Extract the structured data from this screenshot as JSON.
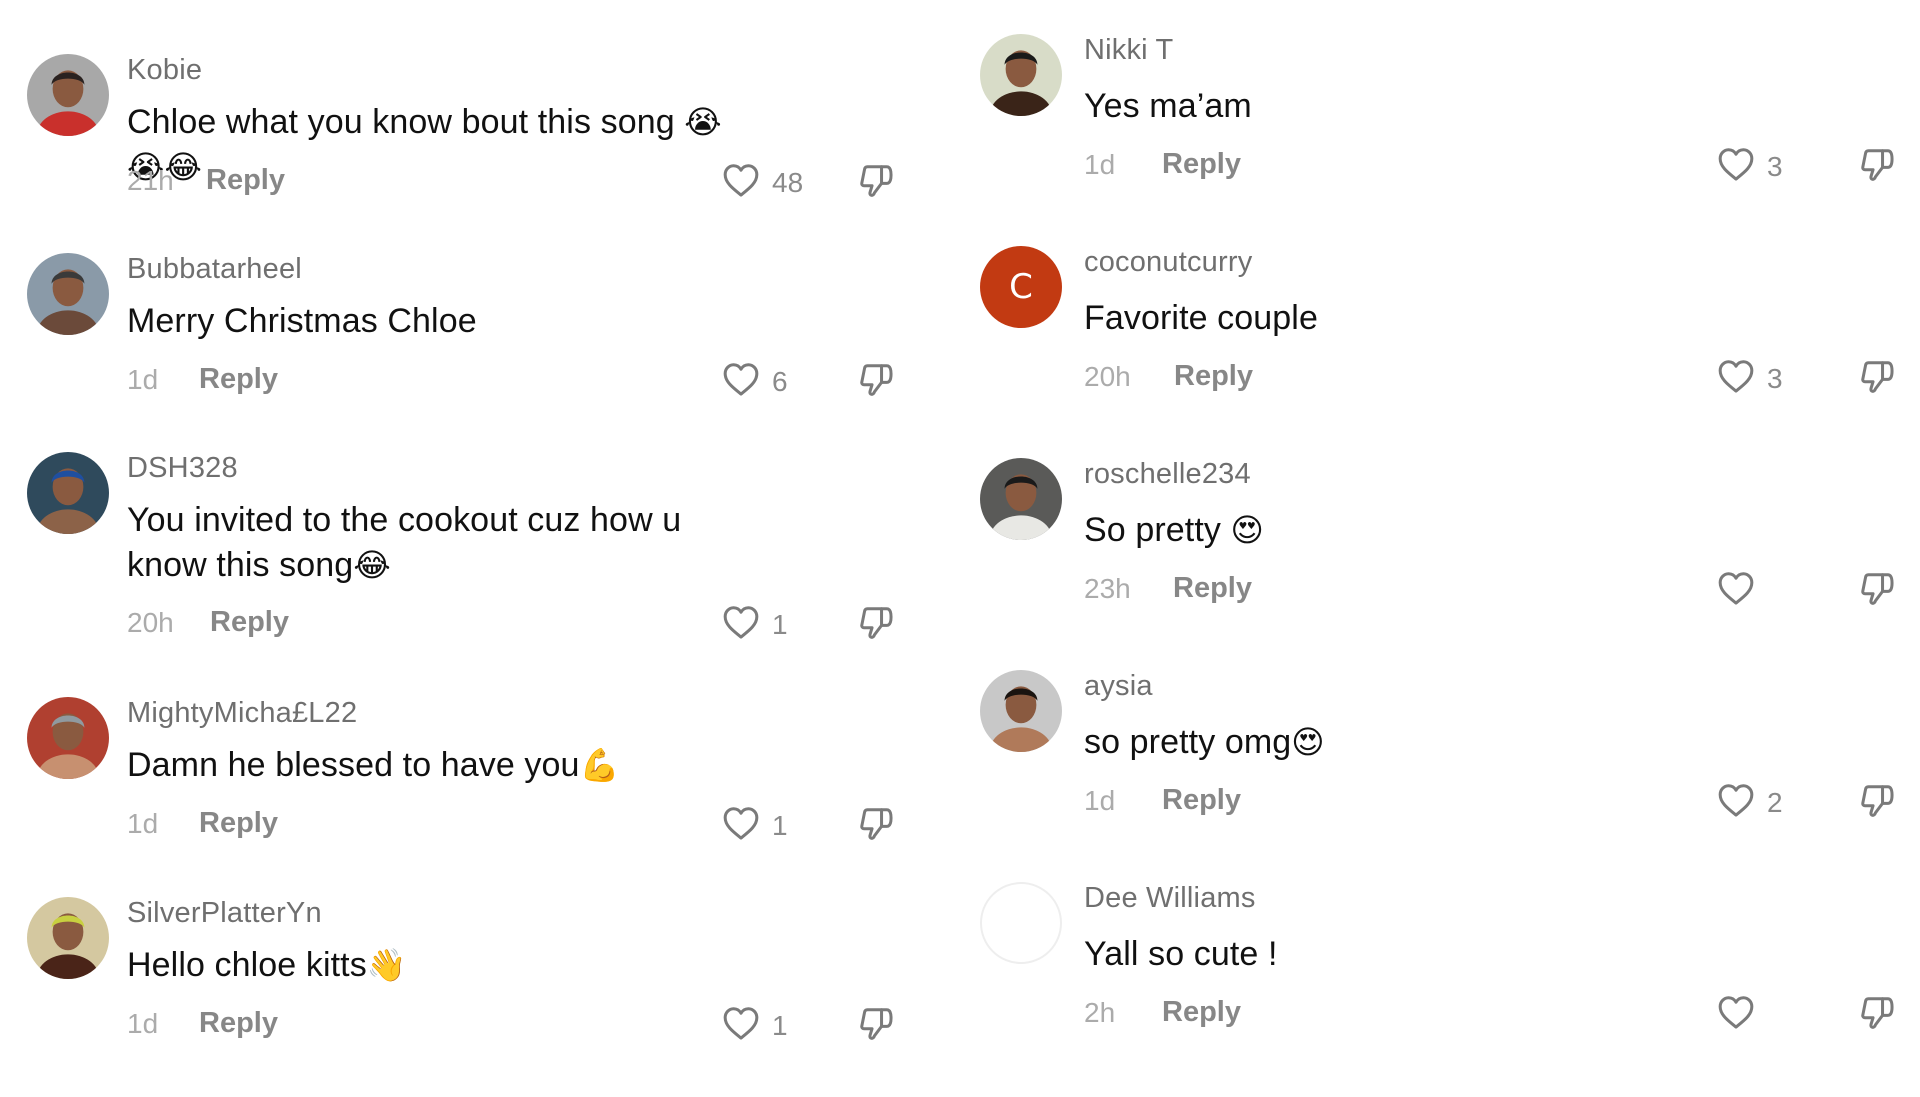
{
  "comments_left": [
    {
      "username": "Kobie",
      "text": "Chloe what you know bout this song ",
      "emoji": "😭😭😂",
      "time": "21h",
      "reply_label": "Reply",
      "likes": "48",
      "avatar": {
        "type": "photo",
        "colors": [
          "#a8a8a8",
          "#c9302c",
          "#2a2220"
        ]
      }
    },
    {
      "username": "Bubbatarheel",
      "text": "Merry Christmas Chloe",
      "emoji": "",
      "time": "1d",
      "reply_label": "Reply",
      "likes": "6",
      "avatar": {
        "type": "photo",
        "colors": [
          "#8a9aa8",
          "#6b4a3a",
          "#3a3a3a"
        ]
      }
    },
    {
      "username": "DSH328",
      "text": "You invited to the cookout cuz how u know this song",
      "emoji": "😂",
      "time": "20h",
      "reply_label": "Reply",
      "likes": "1",
      "avatar": {
        "type": "photo",
        "colors": [
          "#2f4a5c",
          "#8c6248",
          "#1f4fa0"
        ]
      }
    },
    {
      "username": "MightyMicha£L22",
      "text": "Damn he blessed to have you",
      "emoji": "💪",
      "time": "1d",
      "reply_label": "Reply",
      "likes": "1",
      "avatar": {
        "type": "photo",
        "colors": [
          "#b04030",
          "#c79070",
          "#909aa0"
        ]
      }
    },
    {
      "username": "SilverPlatterYn",
      "text": "Hello chloe kitts",
      "emoji": "👋",
      "time": "1d",
      "reply_label": "Reply",
      "likes": "1",
      "avatar": {
        "type": "photo",
        "colors": [
          "#d4c8a0",
          "#4a2418",
          "#c8d040"
        ]
      }
    }
  ],
  "comments_right": [
    {
      "username": "Nikki T",
      "text": "Yes ma’am",
      "emoji": "",
      "time": "1d",
      "reply_label": "Reply",
      "likes": "3",
      "avatar": {
        "type": "photo",
        "colors": [
          "#d8dcc8",
          "#3a2418",
          "#1a1a1a"
        ]
      }
    },
    {
      "username": "coconutcurry",
      "text": "Favorite couple",
      "emoji": "",
      "time": "20h",
      "reply_label": "Reply",
      "likes": "3",
      "avatar": {
        "type": "letter",
        "letter": "C",
        "color": "#c23a12"
      }
    },
    {
      "username": "roschelle234",
      "text": "So pretty ",
      "emoji": "😍",
      "time": "23h",
      "reply_label": "Reply",
      "likes": "",
      "avatar": {
        "type": "photo",
        "colors": [
          "#5a5a58",
          "#e8e8e4",
          "#1a1a1a"
        ]
      }
    },
    {
      "username": "aysia",
      "text": "so pretty omg",
      "emoji": "😍",
      "time": "1d",
      "reply_label": "Reply",
      "likes": "2",
      "avatar": {
        "type": "photo",
        "colors": [
          "#c8c8c8",
          "#b07a5a",
          "#1a1410"
        ]
      }
    },
    {
      "username": "Dee Williams",
      "text": "Yall so cute !",
      "emoji": "",
      "time": "2h",
      "reply_label": "Reply",
      "likes": "",
      "avatar": {
        "type": "empty"
      }
    }
  ]
}
